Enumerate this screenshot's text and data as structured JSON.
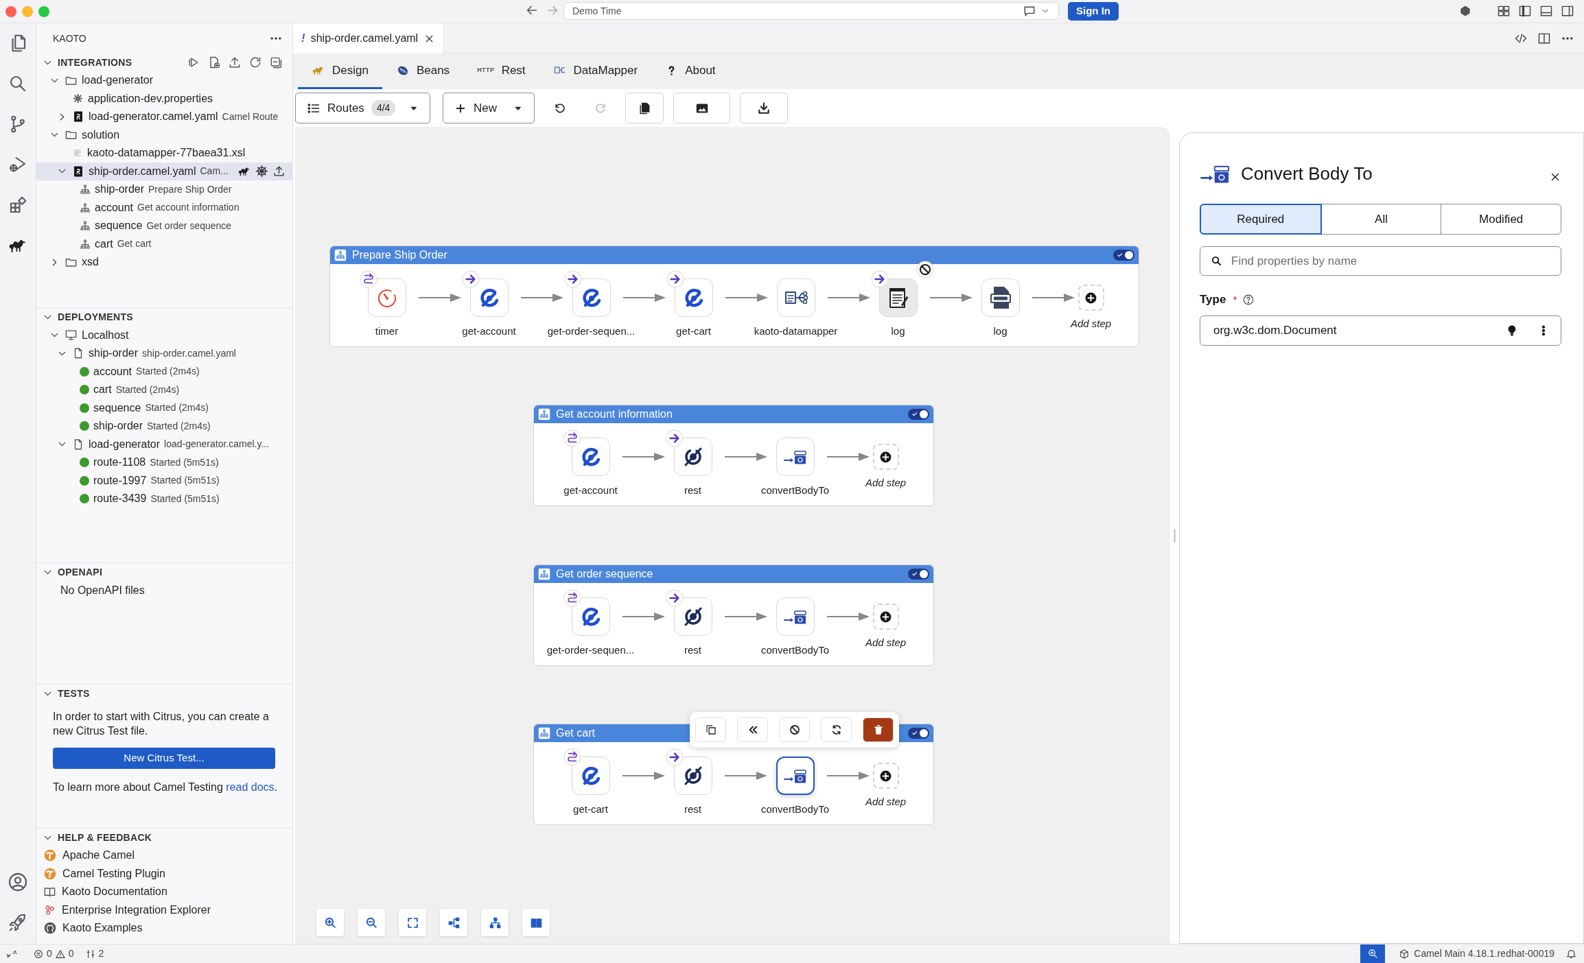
{
  "window": {
    "search_text": "Demo Time",
    "sign_in": "Sign In"
  },
  "sidebar": {
    "title": "KAOTO",
    "sections": [
      {
        "kind": "tree",
        "title": "INTEGRATIONS",
        "expanded": true,
        "items": [
          {
            "label": "load-generator",
            "kind": "folder",
            "expanded": true,
            "selected": false,
            "children": [
              {
                "label": "application-dev.properties",
                "kind": "properties",
                "selected": false
              },
              {
                "label": "load-generator.camel.yaml",
                "description": "Camel Route",
                "kind": "camel-file",
                "expanded": false,
                "selected": false
              }
            ]
          },
          {
            "label": "solution",
            "kind": "folder",
            "expanded": true,
            "selected": false,
            "children": [
              {
                "label": "kaoto-datamapper-77baea31.xsl",
                "kind": "text-file",
                "selected": false
              },
              {
                "label": "ship-order.camel.yaml",
                "description": "Cam...",
                "kind": "camel-file",
                "expanded": true,
                "selected": true,
                "children": [
                  {
                    "label": "ship-order",
                    "description": "Prepare Ship Order",
                    "kind": "route",
                    "selected": false
                  },
                  {
                    "label": "account",
                    "description": "Get account information",
                    "kind": "route",
                    "selected": false
                  },
                  {
                    "label": "sequence",
                    "description": "Get order sequence",
                    "kind": "route",
                    "selected": false
                  },
                  {
                    "label": "cart",
                    "description": "Get cart",
                    "kind": "route",
                    "selected": false
                  }
                ]
              }
            ]
          },
          {
            "label": "xsd",
            "kind": "folder",
            "expanded": false,
            "selected": false
          }
        ]
      },
      {
        "kind": "tree",
        "title": "DEPLOYMENTS",
        "expanded": true,
        "items": [
          {
            "label": "Localhost",
            "kind": "host",
            "expanded": true,
            "children": [
              {
                "label": "ship-order",
                "description": "ship-order.camel.yaml",
                "kind": "file",
                "expanded": true,
                "children": [
                  {
                    "label": "account",
                    "description": "Started (2m4s)",
                    "kind": "status",
                    "color": "#3e9a2c"
                  },
                  {
                    "label": "cart",
                    "description": "Started (2m4s)",
                    "kind": "status",
                    "color": "#3e9a2c"
                  },
                  {
                    "label": "sequence",
                    "description": "Started (2m4s)",
                    "kind": "status",
                    "color": "#3e9a2c"
                  },
                  {
                    "label": "ship-order",
                    "description": "Started (2m4s)",
                    "kind": "status",
                    "color": "#3e9a2c"
                  }
                ]
              },
              {
                "label": "load-generator",
                "description": "load-generator.camel.y...",
                "kind": "file",
                "expanded": true,
                "children": [
                  {
                    "label": "route-1108",
                    "description": "Started (5m51s)",
                    "kind": "status",
                    "color": "#3e9a2c"
                  },
                  {
                    "label": "route-1997",
                    "description": "Started (5m51s)",
                    "kind": "status",
                    "color": "#3e9a2c"
                  },
                  {
                    "label": "route-3439",
                    "description": "Started (5m51s)",
                    "kind": "status",
                    "color": "#3e9a2c"
                  }
                ]
              }
            ]
          }
        ]
      },
      {
        "kind": "message",
        "title": "OPENAPI",
        "expanded": true,
        "text": "No OpenAPI files"
      },
      {
        "kind": "tests",
        "title": "TESTS",
        "expanded": true,
        "text": "In order to start with Citrus, you can create a new Citrus Test file.",
        "button": "New Citrus Test...",
        "learn_text": "To learn more about Camel Testing",
        "learn_link": "read docs",
        "learn_end": "."
      },
      {
        "kind": "links",
        "title": "HELP & FEEDBACK",
        "expanded": true,
        "items": [
          {
            "label": "Apache Camel",
            "kind": "camel"
          },
          {
            "label": "Camel Testing Plugin",
            "kind": "camel"
          },
          {
            "label": "Kaoto Documentation",
            "kind": "book"
          },
          {
            "label": "Enterprise Integration Explorer",
            "kind": "explorer"
          },
          {
            "label": "Kaoto Examples",
            "kind": "github"
          }
        ]
      }
    ]
  },
  "editor": {
    "tabs": [
      {
        "label": "ship-order.camel.yaml",
        "marker": "!",
        "selected": true
      }
    ],
    "view_tabs": [
      {
        "label": "Design",
        "kind": "design",
        "selected": true
      },
      {
        "label": "Beans",
        "kind": "beans",
        "selected": false
      },
      {
        "label": "Rest",
        "kind": "rest",
        "icon_text": "HTTP",
        "selected": false
      },
      {
        "label": "DataMapper",
        "kind": "datamapper",
        "selected": false
      },
      {
        "label": "About",
        "kind": "about",
        "selected": false
      }
    ],
    "toolbar": {
      "routes_label": "Routes",
      "routes_count": "4/4",
      "new_label": "New",
      "undo_disabled": false,
      "redo_disabled": true
    },
    "routes": [
      {
        "title": "Prepare Ship Order",
        "enabled": true,
        "add_step": "Add step",
        "steps": [
          {
            "label": "timer",
            "kind": "timer",
            "starts_route": true,
            "sends_to": false,
            "disabled": false,
            "selected": false
          },
          {
            "label": "get-account",
            "kind": "direct",
            "starts_route": false,
            "sends_to": true,
            "disabled": false,
            "selected": false
          },
          {
            "label": "get-order-sequen...",
            "kind": "direct",
            "starts_route": false,
            "sends_to": true,
            "disabled": false,
            "selected": false
          },
          {
            "label": "get-cart",
            "kind": "direct",
            "starts_route": false,
            "sends_to": true,
            "disabled": false,
            "selected": false
          },
          {
            "label": "kaoto-datamapper",
            "kind": "datamapper",
            "starts_route": false,
            "sends_to": false,
            "disabled": false,
            "selected": false
          },
          {
            "label": "log",
            "kind": "log",
            "starts_route": false,
            "sends_to": true,
            "disabled": true,
            "selected": false
          },
          {
            "label": "log",
            "kind": "logfile",
            "starts_route": false,
            "sends_to": false,
            "disabled": false,
            "selected": false
          }
        ]
      },
      {
        "title": "Get account information",
        "enabled": true,
        "add_step": "Add step",
        "steps": [
          {
            "label": "get-account",
            "kind": "direct",
            "starts_route": true,
            "sends_to": false,
            "disabled": false,
            "selected": false
          },
          {
            "label": "rest",
            "kind": "rest",
            "starts_route": false,
            "sends_to": true,
            "disabled": false,
            "selected": false
          },
          {
            "label": "convertBodyTo",
            "kind": "convert",
            "starts_route": false,
            "sends_to": false,
            "disabled": false,
            "selected": false
          }
        ]
      },
      {
        "title": "Get order sequence",
        "enabled": true,
        "add_step": "Add step",
        "steps": [
          {
            "label": "get-order-sequen...",
            "kind": "direct",
            "starts_route": true,
            "sends_to": false,
            "disabled": false,
            "selected": false
          },
          {
            "label": "rest",
            "kind": "rest",
            "starts_route": false,
            "sends_to": true,
            "disabled": false,
            "selected": false
          },
          {
            "label": "convertBodyTo",
            "kind": "convert",
            "starts_route": false,
            "sends_to": false,
            "disabled": false,
            "selected": false
          }
        ]
      },
      {
        "title": "Get cart",
        "enabled": true,
        "add_step": "Add step",
        "steps": [
          {
            "label": "get-cart",
            "kind": "direct",
            "starts_route": true,
            "sends_to": false,
            "disabled": false,
            "selected": false
          },
          {
            "label": "rest",
            "kind": "rest",
            "starts_route": false,
            "sends_to": true,
            "disabled": false,
            "selected": false
          },
          {
            "label": "convertBodyTo",
            "kind": "convert",
            "starts_route": false,
            "sends_to": false,
            "disabled": false,
            "selected": true
          }
        ]
      }
    ],
    "panel": {
      "title": "Convert Body To",
      "filters": [
        {
          "label": "Required",
          "selected": true
        },
        {
          "label": "All",
          "selected": false
        },
        {
          "label": "Modified",
          "selected": false
        }
      ],
      "search_placeholder": "Find properties by name",
      "field": {
        "label": "Type",
        "required_mark": "*",
        "value": "org.w3c.dom.Document"
      }
    }
  },
  "status_bar": {
    "errors": "0",
    "warnings": "0",
    "ports": "2",
    "runtime": "Camel Main 4.18.1.redhat-00019"
  }
}
